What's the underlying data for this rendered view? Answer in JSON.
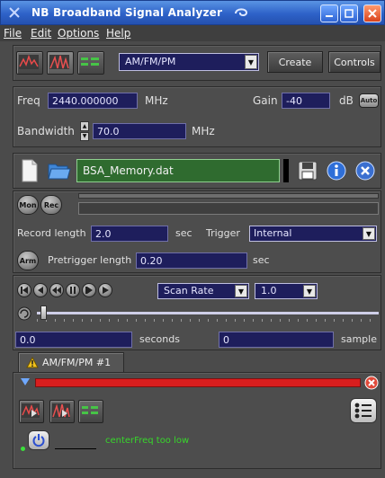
{
  "window": {
    "title": "NB Broadband Signal Analyzer"
  },
  "menu": [
    "File",
    "Edit",
    "Options",
    "Help"
  ],
  "toolbar": {
    "mode_select": "AM/FM/PM",
    "create_label": "Create",
    "controls_label": "Controls"
  },
  "tuning": {
    "freq_label": "Freq",
    "freq_value": "2440.000000",
    "freq_unit": "MHz",
    "gain_label": "Gain",
    "gain_value": "-40",
    "gain_unit": "dB",
    "auto_label": "Auto",
    "bandwidth_label": "Bandwidth",
    "bandwidth_value": "70.0",
    "bandwidth_unit": "MHz"
  },
  "memory": {
    "filename": "BSA_Memory.dat"
  },
  "record": {
    "mon_label": "Mon",
    "rec_label": "Rec",
    "record_length_label": "Record length",
    "record_length_value": "2.0",
    "record_length_unit": "sec",
    "trigger_label": "Trigger",
    "trigger_value": "Internal",
    "arm_label": "Arm",
    "pretrigger_label": "Pretrigger length",
    "pretrigger_value": "0.20",
    "pretrigger_unit": "sec"
  },
  "playback": {
    "rate_select": "Scan Rate",
    "rate_value": "1.0",
    "seconds_value": "0.0",
    "seconds_label": "seconds",
    "sample_value": "0",
    "sample_label": "sample"
  },
  "tab": {
    "label": "AM/FM/PM #1"
  },
  "status": {
    "message": "centerFreq too low",
    "message_color": "#37d62b"
  },
  "colors": {
    "title_bar": "#2e62c8",
    "input_bg": "#1e1e5c",
    "progress_bar": "#d81e1e",
    "filename_bg": "#2f6b2f",
    "info_icon": "#2f6fd8"
  }
}
